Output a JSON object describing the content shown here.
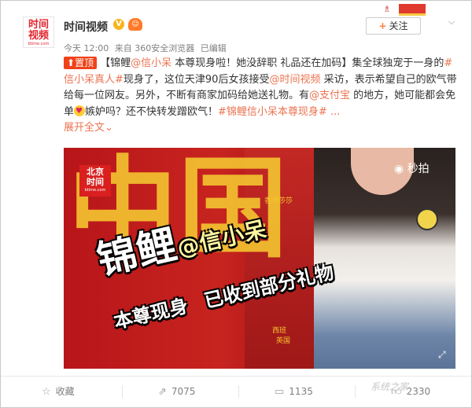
{
  "header": {
    "avatar_line1": "时间",
    "avatar_line2": "视频",
    "avatar_url": "btime.com",
    "username": "时间视频",
    "verified_mark": "V",
    "time": "今天 12:00",
    "source": "来自 360安全浏览器",
    "edited": "已编辑",
    "follow_label": "关注",
    "follow_plus": "+",
    "chevron_icon": "chevron-down-icon"
  },
  "post": {
    "pin_label": "置顶",
    "segments": [
      {
        "t": "【锦鲤",
        "link": false
      },
      {
        "t": "@信小呆",
        "link": true
      },
      {
        "t": " 本尊现身啦！她没辞职  礼品还在加码】集全球独宠于一身的",
        "link": false
      },
      {
        "t": "#信小呆真人#",
        "link": true
      },
      {
        "t": "现身了，这位天津90后女孩接受",
        "link": false
      },
      {
        "t": "@时间视频",
        "link": true
      },
      {
        "t": " 采访，表示希望自己的欧气带给每一位网友。另外，不断有商家加码给她送礼物。有",
        "link": false
      },
      {
        "t": "@支付宝",
        "link": true
      },
      {
        "t": " 的地方，她可能都会免单",
        "link": false
      }
    ],
    "after_emoji": "嫉妒吗？还不快转发蹭欧气！",
    "hashtag_tail": "#锦鲤信小呆本尊现身# ...",
    "expand_label": "展开全文",
    "expand_chevron": "⌄"
  },
  "media": {
    "bj_logo_line1": "北京",
    "bj_logo_line2": "时间",
    "bj_logo_url": "btime.com",
    "miaopai_logo": "秒拍",
    "caption_big": "锦鲤",
    "caption_at": "@信小呆",
    "caption2_a": "本尊现身",
    "caption2_b": "已收到部分礼物",
    "bg_text": "中国",
    "bg_small_1": "香港莎莎",
    "bg_small_2": "西班",
    "bg_small_3": "英国"
  },
  "actions": {
    "favorite_label": "收藏",
    "repost_count": "7075",
    "comment_count": "1135",
    "like_count": "2330"
  },
  "watermark": "系统之家",
  "colors": {
    "link": "#eb7350",
    "pin": "#f0421a",
    "brand_red": "#e3262e"
  }
}
